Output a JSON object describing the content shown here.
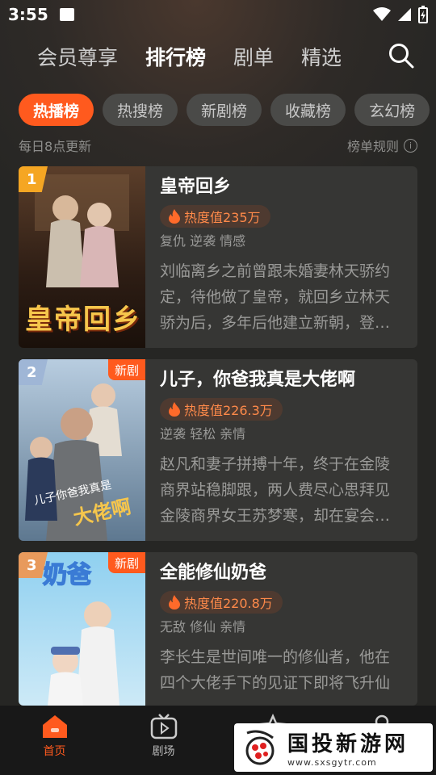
{
  "status_bar": {
    "time": "3:55"
  },
  "top_nav": {
    "tabs": [
      {
        "label": "会员尊享",
        "active": false
      },
      {
        "label": "排行榜",
        "active": true
      },
      {
        "label": "剧单",
        "active": false
      },
      {
        "label": "精选",
        "active": false
      }
    ]
  },
  "chips": [
    {
      "label": "热播榜",
      "active": true
    },
    {
      "label": "热搜榜",
      "active": false
    },
    {
      "label": "新剧榜",
      "active": false
    },
    {
      "label": "收藏榜",
      "active": false
    },
    {
      "label": "玄幻榜",
      "active": false
    }
  ],
  "subheader": {
    "update_note": "每日8点更新",
    "rules_label": "榜单规则"
  },
  "cards": [
    {
      "rank": "1",
      "rank_color": "#f5a623",
      "new_badge": "",
      "poster_text": "皇帝回乡",
      "title": "皇帝回乡",
      "heat": "热度值235万",
      "tags": "复仇 逆袭 情感",
      "desc": "刘临离乡之前曾跟未婚妻林天骄约定，待他做了皇帝，就回乡立林天骄为后，多年后他建立新朝，登…"
    },
    {
      "rank": "2",
      "rank_color": "#9fb6d6",
      "new_badge": "新剧",
      "poster_text": "",
      "title": "儿子，你爸我真是大佬啊",
      "heat": "热度值226.3万",
      "tags": "逆袭 轻松 亲情",
      "desc": "赵凡和妻子拼搏十年，终于在金陵商界站稳脚跟，两人费尽心思拜见金陵商界女王苏梦寒，却在宴会…"
    },
    {
      "rank": "3",
      "rank_color": "#e89a5c",
      "new_badge": "新剧",
      "poster_text": "",
      "title": "全能修仙奶爸",
      "heat": "热度值220.8万",
      "tags": "无敌 修仙 亲情",
      "desc": "李长生是世间唯一的修仙者，他在四个大佬手下的见证下即将飞升仙界，却临门一脚被仇家偷袭…"
    }
  ],
  "bottom_nav": [
    {
      "label": "首页",
      "icon": "home-icon",
      "active": true
    },
    {
      "label": "剧场",
      "icon": "tv-icon",
      "active": false
    },
    {
      "label": "",
      "icon": "star-icon",
      "active": false
    },
    {
      "label": "",
      "icon": "user-icon",
      "active": false
    }
  ],
  "watermark": {
    "title": "国投新游网",
    "url": "www.sxsgytr.com"
  },
  "colors": {
    "accent": "#ff5a1e",
    "card_bg": "#363634",
    "page_bg": "#262624"
  }
}
